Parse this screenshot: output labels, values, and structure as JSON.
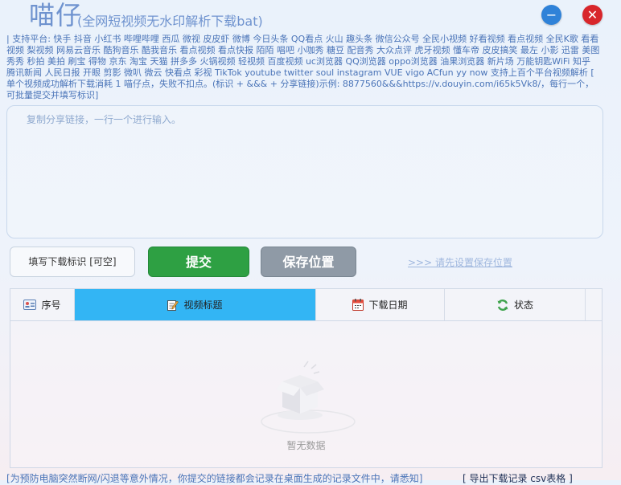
{
  "header": {
    "app_name": "喵仔",
    "subtitle": "(全网短视频无水印解析下载bat)",
    "minimize_symbol": "−",
    "close_symbol": "✕"
  },
  "platform_text": "| 支持平台: 快手 抖音 小红书 哔哩哔哩 西瓜 微视 皮皮虾 微博 今日头条 QQ看点 火山 趣头条 微信公众号 全民小视频 好看视频 看点视频 全民K歌 看看视频 梨视频 网易云音乐 酷狗音乐 酷我音乐 看点视频 看点快报 陌陌 唱吧 小咖秀 糖豆 配音秀 大众点评 虎牙视频 懂车帝 皮皮搞笑 最左 小影 迅雷 美图秀秀 秒拍 美拍 刷宝 得物 京东 淘宝 天猫 拼多多 火锅视频 轻视频 百度视频 uc浏览器 QQ浏览器 oppo浏览器 油果浏览器 新片场 万能钥匙WiFi 知乎 腾讯新闻 人民日报 开眼 剪影 微叭 微云 快看点 彩视 TikTok youtube twitter soul instagram VUE vigo ACfun yy now 支持上百个平台视频解析 [ 单个视频成功解析下载消耗 1 喵仔点，失败不扣点。(标识 + &&& + 分享链接)示例: 8877560&&&https://v.douyin.com/i65k5Vk8/，每行一个，可批量提交并填写标识]",
  "input": {
    "placeholder": "复制分享链接，一行一个进行输入。",
    "value": ""
  },
  "controls": {
    "tag_placeholder": "填写下载标识 [可空]",
    "submit_label": "提交",
    "save_location_label": "保存位置",
    "save_hint": ">>> 请先设置保存位置"
  },
  "table": {
    "columns": [
      {
        "label": "序号",
        "icon": "id-card-icon"
      },
      {
        "label": "视频标题",
        "icon": "edit-note-icon"
      },
      {
        "label": "下载日期",
        "icon": "calendar-icon"
      },
      {
        "label": "状态",
        "icon": "refresh-icon"
      }
    ],
    "active_column": 1,
    "active_color": "#33b5f4",
    "rows": [],
    "empty_text": "暂无数据"
  },
  "footer": {
    "note": "[为预防电脑突然断网/闪退等意外情况，你提交的链接都会记录在桌面生成的记录文件中，请悉知]",
    "export_label": "[ 导出下载记录 csv表格 ]"
  },
  "colors": {
    "accent": "#4a74b8",
    "submit": "#2ea043",
    "save": "#8f9aa6",
    "minimize": "#2f82d8",
    "close": "#d8262b"
  }
}
